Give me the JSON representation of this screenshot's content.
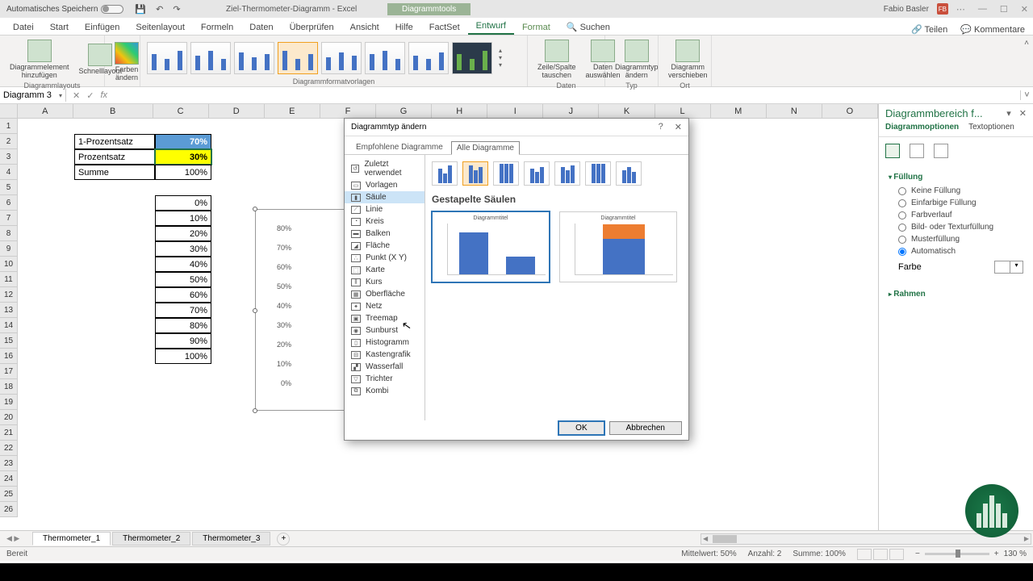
{
  "titlebar": {
    "autosave": "Automatisches Speichern",
    "doc": "Ziel-Thermometer-Diagramm - Excel",
    "tool": "Diagrammtools",
    "user": "Fabio Basler",
    "badge": "FB"
  },
  "tabs": {
    "items": [
      "Datei",
      "Start",
      "Einfügen",
      "Seitenlayout",
      "Formeln",
      "Daten",
      "Überprüfen",
      "Ansicht",
      "Hilfe",
      "FactSet"
    ],
    "context": [
      "Entwurf",
      "Format"
    ],
    "active": "Entwurf",
    "search": "Suchen",
    "share": "Teilen",
    "comments": "Kommentare"
  },
  "ribbon": {
    "g1": {
      "a": "Diagrammelement hinzufügen",
      "b": "Schnelllayout",
      "label": "Diagrammlayouts"
    },
    "g2": {
      "a": "Farben ändern"
    },
    "g3": {
      "label": "Diagrammformatvorlagen"
    },
    "g4": {
      "a": "Zeile/Spalte tauschen",
      "b": "Daten auswählen",
      "label": "Daten"
    },
    "g5": {
      "a": "Diagrammtyp ändern",
      "label": "Typ"
    },
    "g6": {
      "a": "Diagramm verschieben",
      "label": "Ort"
    }
  },
  "namebox": "Diagramm 3",
  "sheet_data": {
    "b2": "1-Prozentsatz",
    "c2": "70%",
    "b3": "Prozentsatz",
    "c3": "30%",
    "b4": "Summe",
    "c4": "100%",
    "c6": "0%",
    "c7": "10%",
    "c8": "20%",
    "c9": "30%",
    "c10": "40%",
    "c11": "50%",
    "c12": "60%",
    "c13": "70%",
    "c14": "80%",
    "c15": "90%",
    "c16": "100%"
  },
  "chart_axis": [
    "80%",
    "70%",
    "60%",
    "50%",
    "40%",
    "30%",
    "20%",
    "10%",
    "0%"
  ],
  "dialog": {
    "title": "Diagrammtyp ändern",
    "tab1": "Empfohlene Diagramme",
    "tab2": "Alle Diagramme",
    "types": [
      "Zuletzt verwendet",
      "Vorlagen",
      "Säule",
      "Linie",
      "Kreis",
      "Balken",
      "Fläche",
      "Punkt (X Y)",
      "Karte",
      "Kurs",
      "Oberfläche",
      "Netz",
      "Treemap",
      "Sunburst",
      "Histogramm",
      "Kastengrafik",
      "Wasserfall",
      "Trichter",
      "Kombi"
    ],
    "selected_type": "Säule",
    "subtype_title": "Gestapelte Säulen",
    "preview_title": "Diagrammtitel",
    "ok": "OK",
    "cancel": "Abbrechen"
  },
  "pane": {
    "title": "Diagrammbereich f...",
    "tab1": "Diagrammoptionen",
    "tab2": "Textoptionen",
    "fill": "Füllung",
    "opts": [
      "Keine Füllung",
      "Einfarbige Füllung",
      "Farbverlauf",
      "Bild- oder Texturfüllung",
      "Musterfüllung",
      "Automatisch"
    ],
    "color": "Farbe",
    "border": "Rahmen"
  },
  "sheets": {
    "tabs": [
      "Thermometer_1",
      "Thermometer_2",
      "Thermometer_3"
    ]
  },
  "status": {
    "ready": "Bereit",
    "avg": "Mittelwert: 50%",
    "count": "Anzahl: 2",
    "sum": "Summe: 100%",
    "zoom": "130 %"
  },
  "chart_data": {
    "type": "bar",
    "title": "Diagrammtitel",
    "previews": [
      {
        "style": "clustered-stacked",
        "series": [
          {
            "name": "",
            "values": [
              70,
              30
            ]
          }
        ],
        "categories": [
          "",
          ""
        ]
      },
      {
        "style": "stacked",
        "categories": [
          ""
        ],
        "series": [
          {
            "name": "1-Prozentsatz",
            "value": 70,
            "color": "#4472c4"
          },
          {
            "name": "Prozentsatz",
            "value": 30,
            "color": "#ed7d31"
          }
        ]
      }
    ],
    "ylim": [
      0,
      80
    ]
  }
}
